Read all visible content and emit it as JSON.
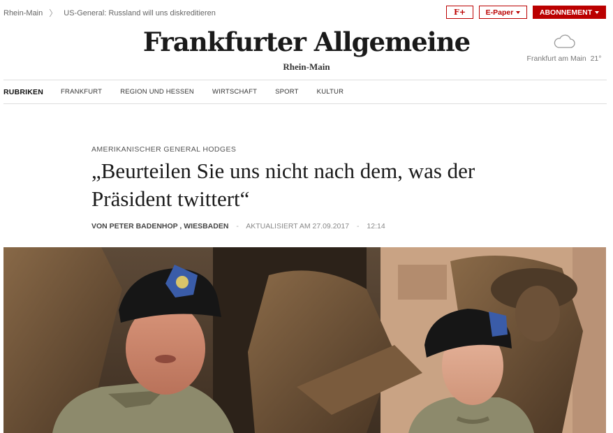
{
  "breadcrumb": {
    "items": [
      "Rhein-Main",
      "US-General: Russland will uns diskreditieren"
    ],
    "separator": "〉"
  },
  "top_buttons": {
    "fplus": "F+",
    "epaper": "E-Paper",
    "abo": "ABONNEMENT"
  },
  "masthead": {
    "logo": "Frankfurter Allgemeine",
    "edition": "Rhein-Main"
  },
  "weather": {
    "location": "Frankfurt am Main",
    "temperature": "21°",
    "icon": "cloud-icon"
  },
  "nav": {
    "label": "RUBRIKEN",
    "items": [
      "FRANKFURT",
      "REGION UND HESSEN",
      "WIRTSCHAFT",
      "SPORT",
      "KULTUR"
    ]
  },
  "article": {
    "kicker": "AMERIKANISCHER GENERAL HODGES",
    "headline": "„Beurteilen Sie uns nicht nach dem, was der Präsident twittert“",
    "author": "VON PETER BADENHOP , WIESBADEN",
    "updated": "AKTUALISIERT AM 27.09.2017",
    "time": "12:14"
  },
  "colors": {
    "brand_red": "#b00000"
  }
}
